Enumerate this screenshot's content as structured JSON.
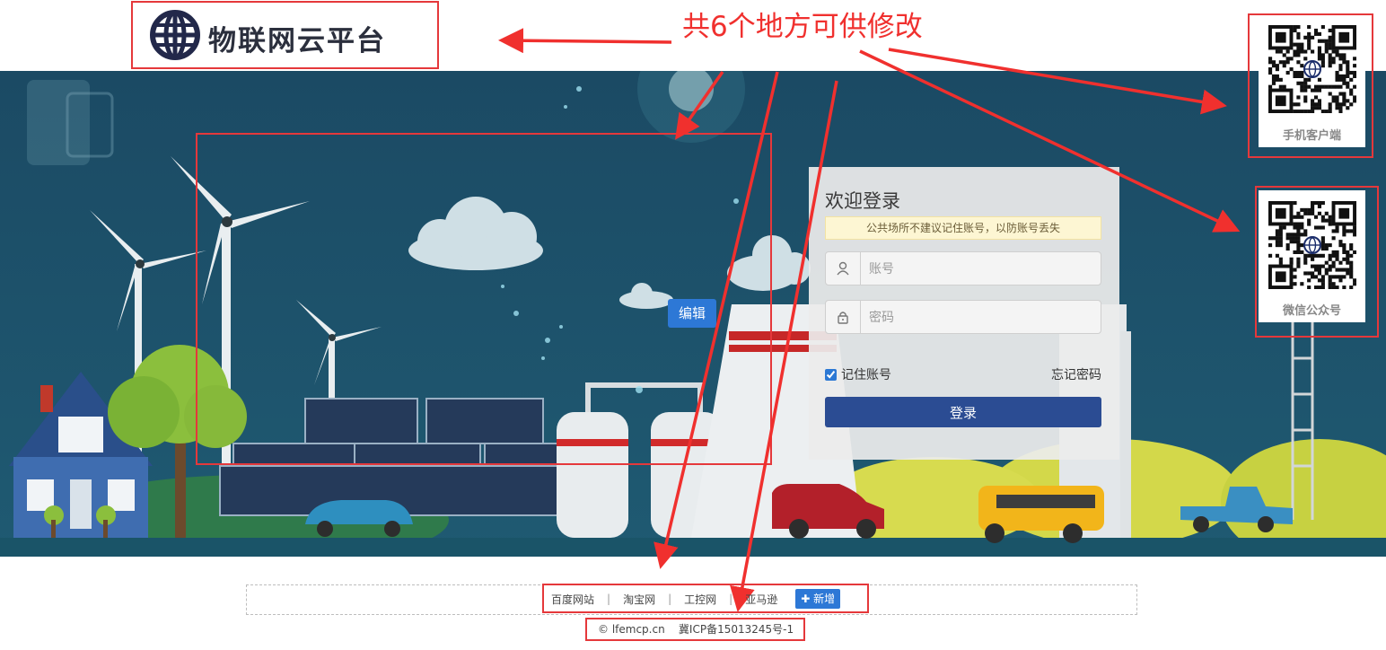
{
  "header": {
    "logo_text": "物联网云平台",
    "annotation": "共6个地方可供修改"
  },
  "banner": {
    "edit_label": "编辑"
  },
  "login": {
    "title": "欢迎登录",
    "tip": "公共场所不建议记住账号，以防账号丢失",
    "account_placeholder": "账号",
    "password_placeholder": "密码",
    "remember_label": "记住账号",
    "remember_checked": true,
    "forgot_label": "忘记密码",
    "submit_label": "登录"
  },
  "qr": {
    "mobile_caption": "手机客户端",
    "wechat_caption": "微信公众号"
  },
  "footer": {
    "links": [
      "百度网站",
      "淘宝网",
      "工控网",
      "亚马逊"
    ],
    "add_label": "新增",
    "copyright": "© lfemcp.cn    冀ICP备15013245号-1"
  },
  "colors": {
    "annotation_red": "#e5383b",
    "primary_blue": "#2d78d6",
    "login_button": "#2b4c93",
    "banner_sky": "#1c4f67"
  }
}
